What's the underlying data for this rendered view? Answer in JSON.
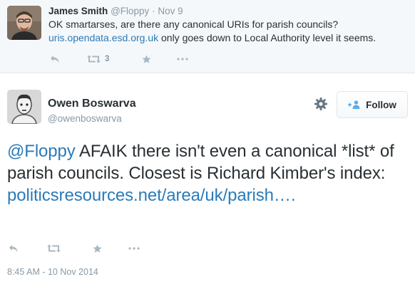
{
  "parent_tweet": {
    "author_name": "James Smith",
    "author_handle": "@Floppy",
    "separator": "·",
    "date": "Nov 9",
    "text_line1": "OK smartarses, are there any canonical URIs for parish councils?",
    "text_link": "uris.opendata.esd.org.uk",
    "text_rest": " only goes down to Local Authority level it seems.",
    "retweet_count": "3"
  },
  "main_tweet": {
    "author_name": "Owen Boswarva",
    "author_handle": "@owenboswarva",
    "follow_label": "Follow",
    "mention": "@Floppy",
    "text": " AFAIK there isn't even a canonical *list* of parish councils. Closest is Richard Kimber's index: ",
    "link": "politicsresources.net/area/uk/parish….",
    "timestamp": "8:45 AM - 10 Nov 2014"
  },
  "icons": {
    "reply": "reply-icon",
    "retweet": "retweet-icon",
    "favorite": "star-icon",
    "more": "more-icon",
    "settings": "gear-icon",
    "follow": "follow-person-icon"
  },
  "colors": {
    "link": "#2b7bb9",
    "muted": "#8899a6",
    "icon": "#aab8c2",
    "parent_background": "#f5f8fa"
  }
}
